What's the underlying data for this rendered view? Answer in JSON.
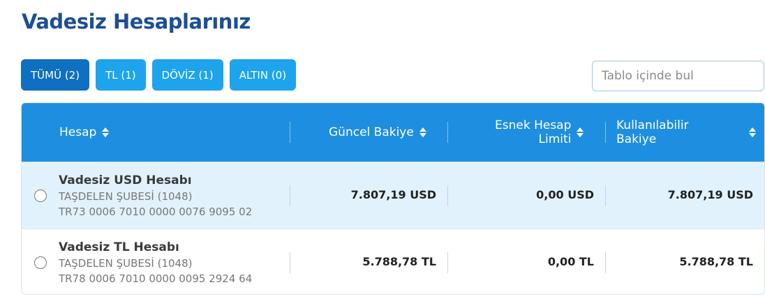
{
  "page_title": "Vadesiz Hesaplarınız",
  "filters": [
    {
      "label": "TÜMÜ (2)",
      "active": true
    },
    {
      "label": "TL (1)",
      "active": false
    },
    {
      "label": "DÖVİZ (1)",
      "active": false
    },
    {
      "label": "ALTIN (0)",
      "active": false
    }
  ],
  "search": {
    "placeholder": "Tablo içinde bul",
    "icon": "search-icon"
  },
  "table": {
    "columns": {
      "account": "Hesap",
      "current_balance": "Güncel Bakiye",
      "flex_limit_line1": "Esnek Hesap",
      "flex_limit_line2": "Limiti",
      "available_line1": "Kullanılabilir",
      "available_line2": "Bakiye"
    },
    "rows": [
      {
        "name": "Vadesiz USD Hesabı",
        "branch": "TAŞDELEN ŞUBESİ (1048)",
        "iban": "TR73 0006 7010 0000 0076 9095 02",
        "current_balance": "7.807,19 USD",
        "flex_limit": "0,00 USD",
        "available": "7.807,19 USD"
      },
      {
        "name": "Vadesiz TL Hesabı",
        "branch": "TAŞDELEN ŞUBESİ (1048)",
        "iban": "TR78 0006 7010 0000 0095 2924 64",
        "current_balance": "5.788,78 TL",
        "flex_limit": "0,00 TL",
        "available": "5.788,78 TL"
      }
    ]
  },
  "colors": {
    "title": "#1c4f94",
    "header_bg": "#1e8fe0",
    "button": "#1ea4ec",
    "button_active": "#0f6fc0",
    "selected_row": "#e2f2fd"
  }
}
